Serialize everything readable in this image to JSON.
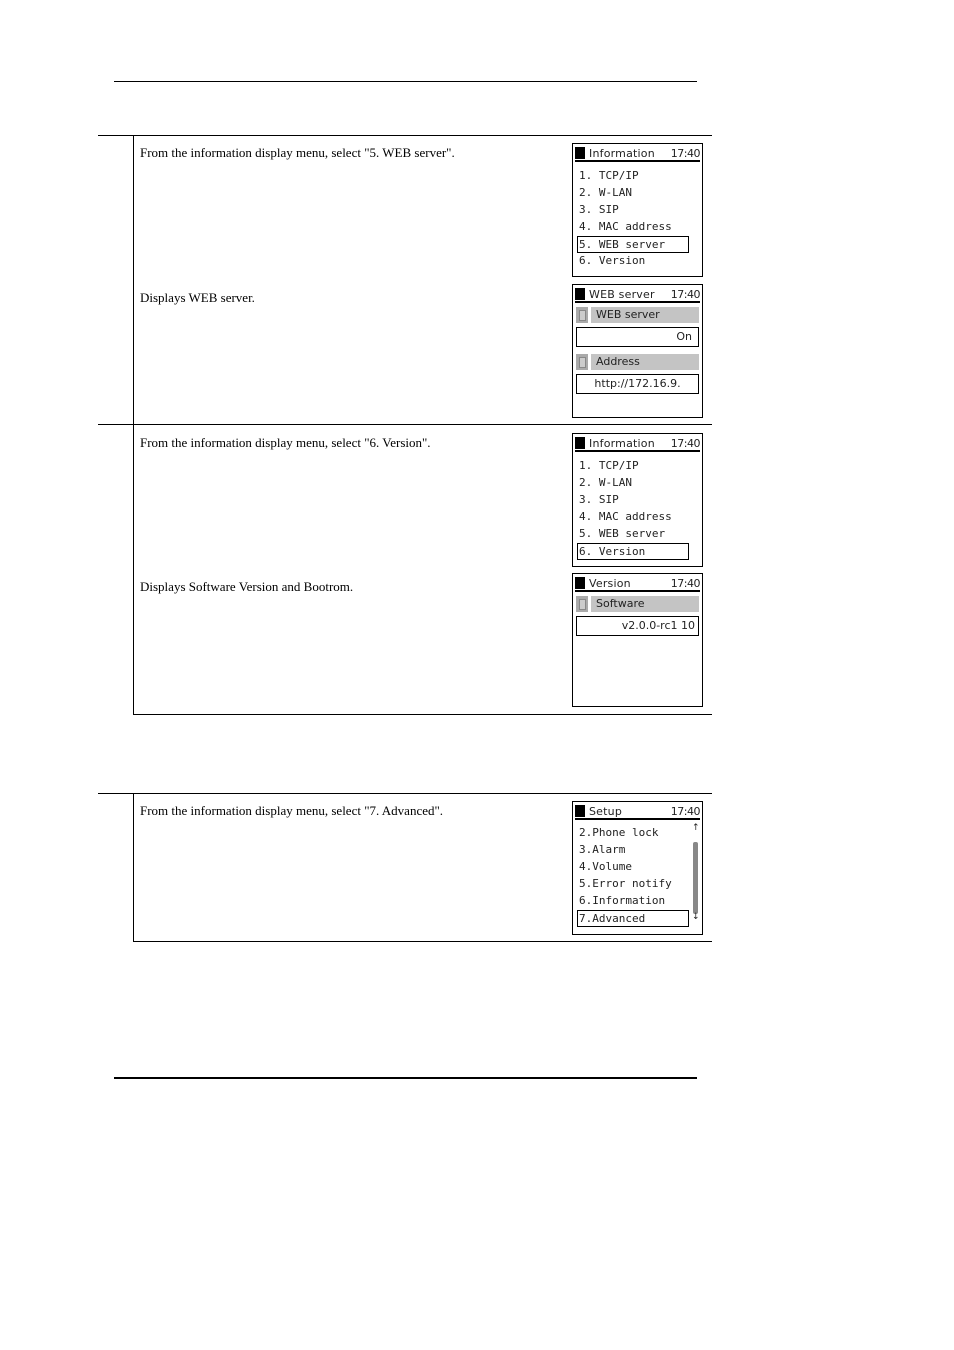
{
  "steps": [
    {
      "instruction": "From the information display menu, select \"5. WEB server\".",
      "screen": {
        "title": "Information",
        "clock": "17:40",
        "items": [
          "1. TCP/IP",
          "2. W-LAN",
          "3. SIP",
          "4. MAC address",
          "5. WEB server",
          "6. Version"
        ],
        "selected_index": 4
      }
    },
    {
      "instruction": "Displays WEB server.",
      "screen": {
        "title": "WEB server",
        "clock": "17:40",
        "fields": [
          {
            "label": "WEB server",
            "value": "On"
          },
          {
            "label": "Address",
            "value": "http://172.16.9."
          }
        ]
      }
    },
    {
      "instruction": "From the information display menu, select \"6. Version\".",
      "screen": {
        "title": "Information",
        "clock": "17:40",
        "items": [
          "1. TCP/IP",
          "2. W-LAN",
          "3. SIP",
          "4. MAC address",
          "5. WEB server",
          "6. Version"
        ],
        "selected_index": 5
      }
    },
    {
      "instruction": "Displays Software Version and Bootrom.",
      "screen": {
        "title": "Version",
        "clock": "17:40",
        "fields": [
          {
            "label": "Software",
            "value": "v2.0.0-rc1 10"
          }
        ]
      }
    },
    {
      "instruction": "From the information display menu, select \"7. Advanced\".",
      "screen": {
        "title": "Setup",
        "clock": "17:40",
        "items": [
          "2.Phone lock",
          "3.Alarm",
          "4.Volume",
          "5.Error notify",
          "6.Information",
          "7.Advanced"
        ],
        "selected_index": 5,
        "scroll_up_icon": "↑",
        "scroll_down_icon": "↓"
      }
    }
  ]
}
